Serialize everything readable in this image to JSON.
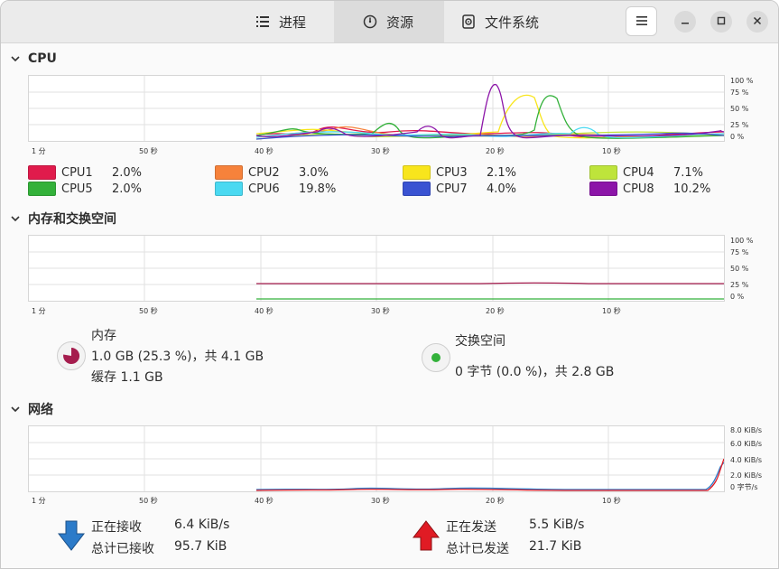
{
  "header": {
    "tabs": [
      {
        "label": "进程",
        "icon": "list-icon",
        "active": false
      },
      {
        "label": "资源",
        "icon": "gauge-icon",
        "active": true
      },
      {
        "label": "文件系统",
        "icon": "disk-icon",
        "active": false
      }
    ],
    "menu_icon": "hamburger-icon"
  },
  "cpu": {
    "title": "CPU",
    "y_ticks": [
      "100 %",
      "75 %",
      "50 %",
      "25 %",
      "0 %"
    ],
    "x_ticks": [
      "1 分",
      "50 秒",
      "40 秒",
      "30 秒",
      "20 秒",
      "10 秒"
    ],
    "legend": [
      {
        "name": "CPU1",
        "value": "2.0%",
        "color": "#e01b4c"
      },
      {
        "name": "CPU2",
        "value": "3.0%",
        "color": "#f6823b"
      },
      {
        "name": "CPU3",
        "value": "2.1%",
        "color": "#f8e51c"
      },
      {
        "name": "CPU4",
        "value": "7.1%",
        "color": "#bee43b"
      },
      {
        "name": "CPU5",
        "value": "2.0%",
        "color": "#33b13a"
      },
      {
        "name": "CPU6",
        "value": "19.8%",
        "color": "#4ad9f1"
      },
      {
        "name": "CPU7",
        "value": "4.0%",
        "color": "#3a53d2"
      },
      {
        "name": "CPU8",
        "value": "10.2%",
        "color": "#8c15a8"
      }
    ]
  },
  "memory": {
    "title": "内存和交换空间",
    "y_ticks": [
      "100 %",
      "75 %",
      "50 %",
      "25 %",
      "0 %"
    ],
    "x_ticks": [
      "1 分",
      "50 秒",
      "40 秒",
      "30 秒",
      "20 秒",
      "10 秒"
    ],
    "mem_label": "内存",
    "mem_value": "1.0 GB (25.3 %)，共 4.1 GB",
    "cache_value": "缓存 1.1 GB",
    "mem_color": "#a51d4e",
    "swap_label": "交换空间",
    "swap_value": "0 字节 (0.0 %)，共 2.8 GB",
    "swap_color": "#33b13a"
  },
  "network": {
    "title": "网络",
    "y_ticks": [
      "8.0 KiB/s",
      "6.0 KiB/s",
      "4.0 KiB/s",
      "2.0 KiB/s",
      "0 字节/s"
    ],
    "x_ticks": [
      "1 分",
      "50 秒",
      "40 秒",
      "30 秒",
      "20 秒",
      "10 秒"
    ],
    "recv_label": "正在接收",
    "recv_value": "6.4 KiB/s",
    "recv_total_label": "总计已接收",
    "recv_total_value": "95.7 KiB",
    "send_label": "正在发送",
    "send_value": "5.5 KiB/s",
    "send_total_label": "总计已发送",
    "send_total_value": "21.7 KiB",
    "recv_color": "#2c7bc9",
    "send_color": "#e01b24"
  }
}
